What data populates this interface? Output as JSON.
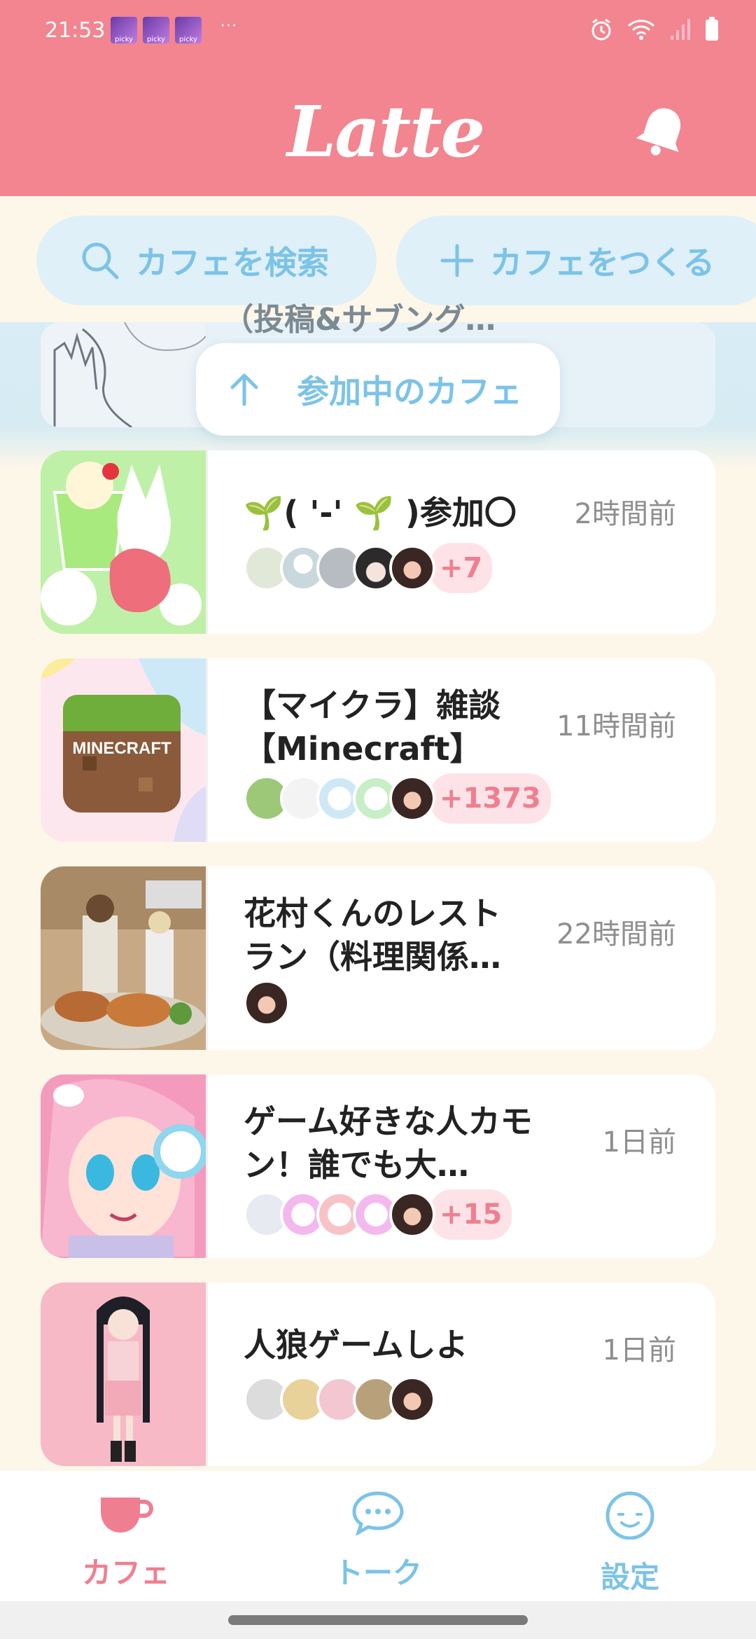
{
  "status_bar": {
    "time": "21:53",
    "more": "···",
    "notification_thumbs": [
      "picky",
      "picky",
      "picky"
    ]
  },
  "header": {
    "logo": "Latte",
    "bell_icon": "bell-icon"
  },
  "actions": {
    "search_label": "カフェを検索",
    "create_label": "カフェをつくる"
  },
  "peek": {
    "title": "（投稿&サブング…",
    "joined_cafes_label": "参加中のカフェ"
  },
  "cafes": [
    {
      "title": "🌱( '-' 🌱 )参加〇",
      "time": "2時間前",
      "more": "+7"
    },
    {
      "title": "【マイクラ】雑談【Minecraft】",
      "time": "11時間前",
      "more": "+1373",
      "logo_text": "MINECRAFT"
    },
    {
      "title": "花村くんのレストラン（料理関係…",
      "time": "22時間前"
    },
    {
      "title": "ゲーム好きな人カモン！誰でも大…",
      "time": "1日前",
      "more": "+15"
    },
    {
      "title": "人狼ゲームしよ",
      "time": "1日前"
    }
  ],
  "nav": {
    "cafe": "カフェ",
    "talk": "トーク",
    "settings": "設定",
    "active": "cafe"
  },
  "colors": {
    "header": "#f2858f",
    "accent_blue": "#7cc3e8",
    "accent_pink": "#ef7f90"
  }
}
